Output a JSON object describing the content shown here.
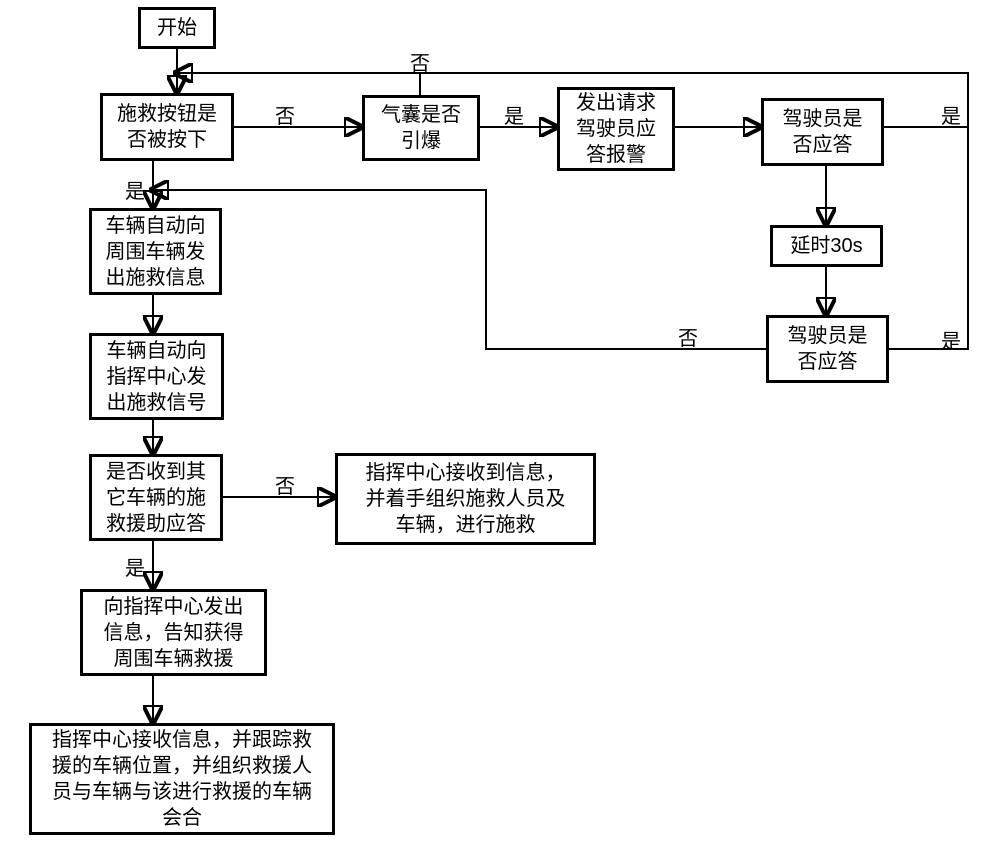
{
  "nodes": {
    "start": "开始",
    "rescueButtonPressed": "施救按钮是\n否被按下",
    "airbagExploded": "气囊是否\n引爆",
    "requestDriverAlarm": "发出请求\n驾驶员应\n答报警",
    "driverRespond1": "驾驶员是\n否应答",
    "delay30s": "延时30s",
    "driverRespond2": "驾驶员是\n否应答",
    "autoSendNearby": "车辆自动向\n周围车辆发\n出施救信息",
    "autoSendCenter": "车辆自动向\n指挥中心发\n出施救信号",
    "receivedRescueResponse": "是否收到其\n它车辆的施\n救援助应答",
    "centerReceiveNoResp": "指挥中心接收到信息，\n并着手组织施救人员及\n车辆，进行施救",
    "informCenterGotRescue": "向指挥中心发出\n信息，告知获得\n周围车辆救援",
    "centerTrackAndJoin": "指挥中心接收信息，并跟踪救\n援的车辆位置，并组织救援人\n员与车辆与该进行救援的车辆\n会合"
  },
  "labels": {
    "yes": "是",
    "no": "否"
  }
}
